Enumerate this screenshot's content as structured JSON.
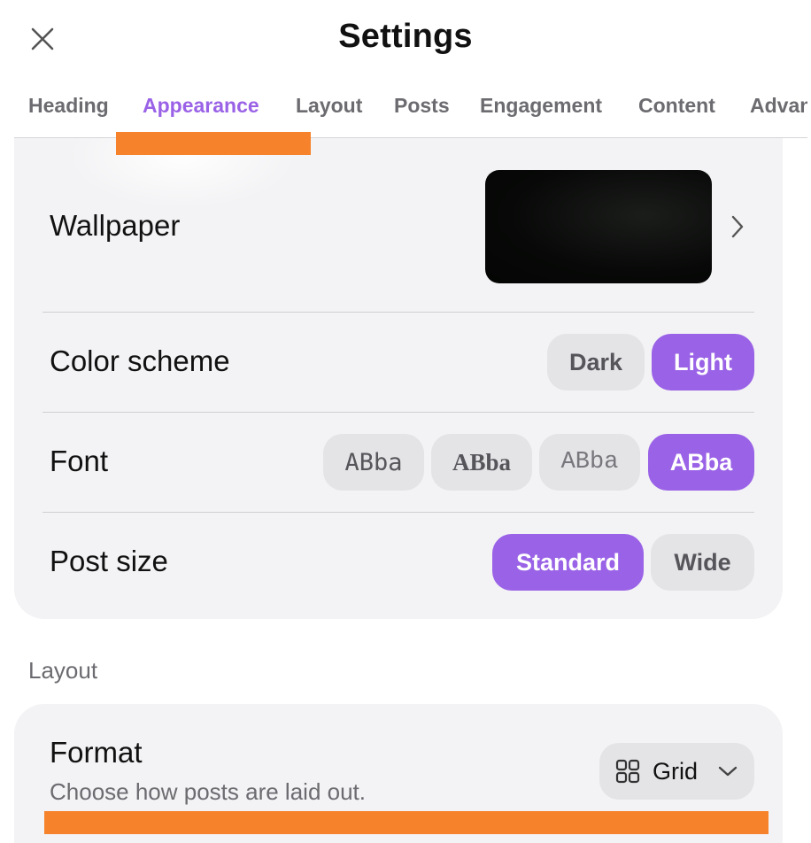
{
  "header": {
    "title": "Settings"
  },
  "tabs": [
    {
      "label": "Heading",
      "active": false
    },
    {
      "label": "Appearance",
      "active": true
    },
    {
      "label": "Layout",
      "active": false
    },
    {
      "label": "Posts",
      "active": false
    },
    {
      "label": "Engagement",
      "active": false
    },
    {
      "label": "Content",
      "active": false
    },
    {
      "label": "Advan",
      "active": false
    }
  ],
  "appearance": {
    "wallpaper_label": "Wallpaper",
    "color_scheme": {
      "label": "Color scheme",
      "options": [
        "Dark",
        "Light"
      ],
      "selected": "Light"
    },
    "font": {
      "label": "Font",
      "options": [
        "ABba",
        "ABba",
        "ABba",
        "ABba"
      ],
      "selected_index": 3
    },
    "post_size": {
      "label": "Post size",
      "options": [
        "Standard",
        "Wide"
      ],
      "selected": "Standard"
    }
  },
  "layout_section": {
    "title": "Layout",
    "format": {
      "label": "Format",
      "description": "Choose how posts are laid out.",
      "value": "Grid"
    }
  },
  "colors": {
    "accent": "#9a62e6",
    "highlight": "#f6822b",
    "card_bg": "#f3f3f5",
    "segment_off": "#e4e4e7"
  },
  "icons": [
    "close-icon",
    "chevron-right-icon",
    "grid-icon",
    "chevron-down-icon"
  ]
}
